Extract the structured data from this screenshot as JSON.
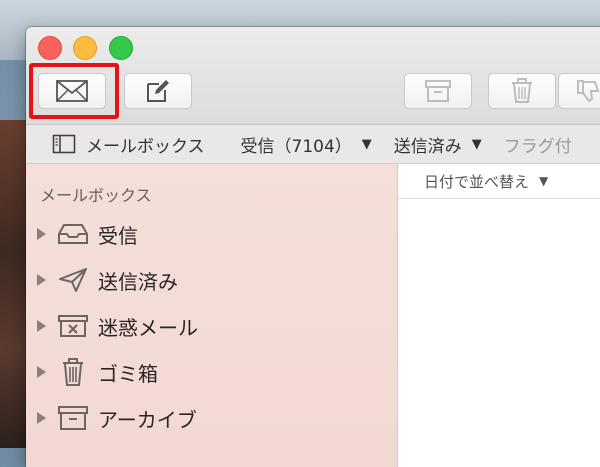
{
  "toolbar": {
    "get_mail": "get-mail-envelope-icon",
    "compose": "compose-icon",
    "archive": "archive-icon",
    "delete": "trash-icon",
    "junk": "thumbs-down-icon"
  },
  "favorites_bar": {
    "mailboxes_label": "メールボックス",
    "inbox_label": "受信（7104）",
    "sent_label": "送信済み",
    "flagged_label": "フラグ付"
  },
  "sidebar": {
    "heading": "メールボックス",
    "items": [
      {
        "label": "受信",
        "icon": "inbox-tray-icon"
      },
      {
        "label": "送信済み",
        "icon": "paper-plane-icon"
      },
      {
        "label": "迷惑メール",
        "icon": "junk-box-icon"
      },
      {
        "label": "ゴミ箱",
        "icon": "trash-icon"
      },
      {
        "label": "アーカイブ",
        "icon": "archive-box-icon"
      }
    ]
  },
  "message_list": {
    "sort_label": "日付で並べ替え"
  },
  "colors": {
    "highlight": "#e6121a",
    "sidebar_bg": "#f3dad6"
  }
}
